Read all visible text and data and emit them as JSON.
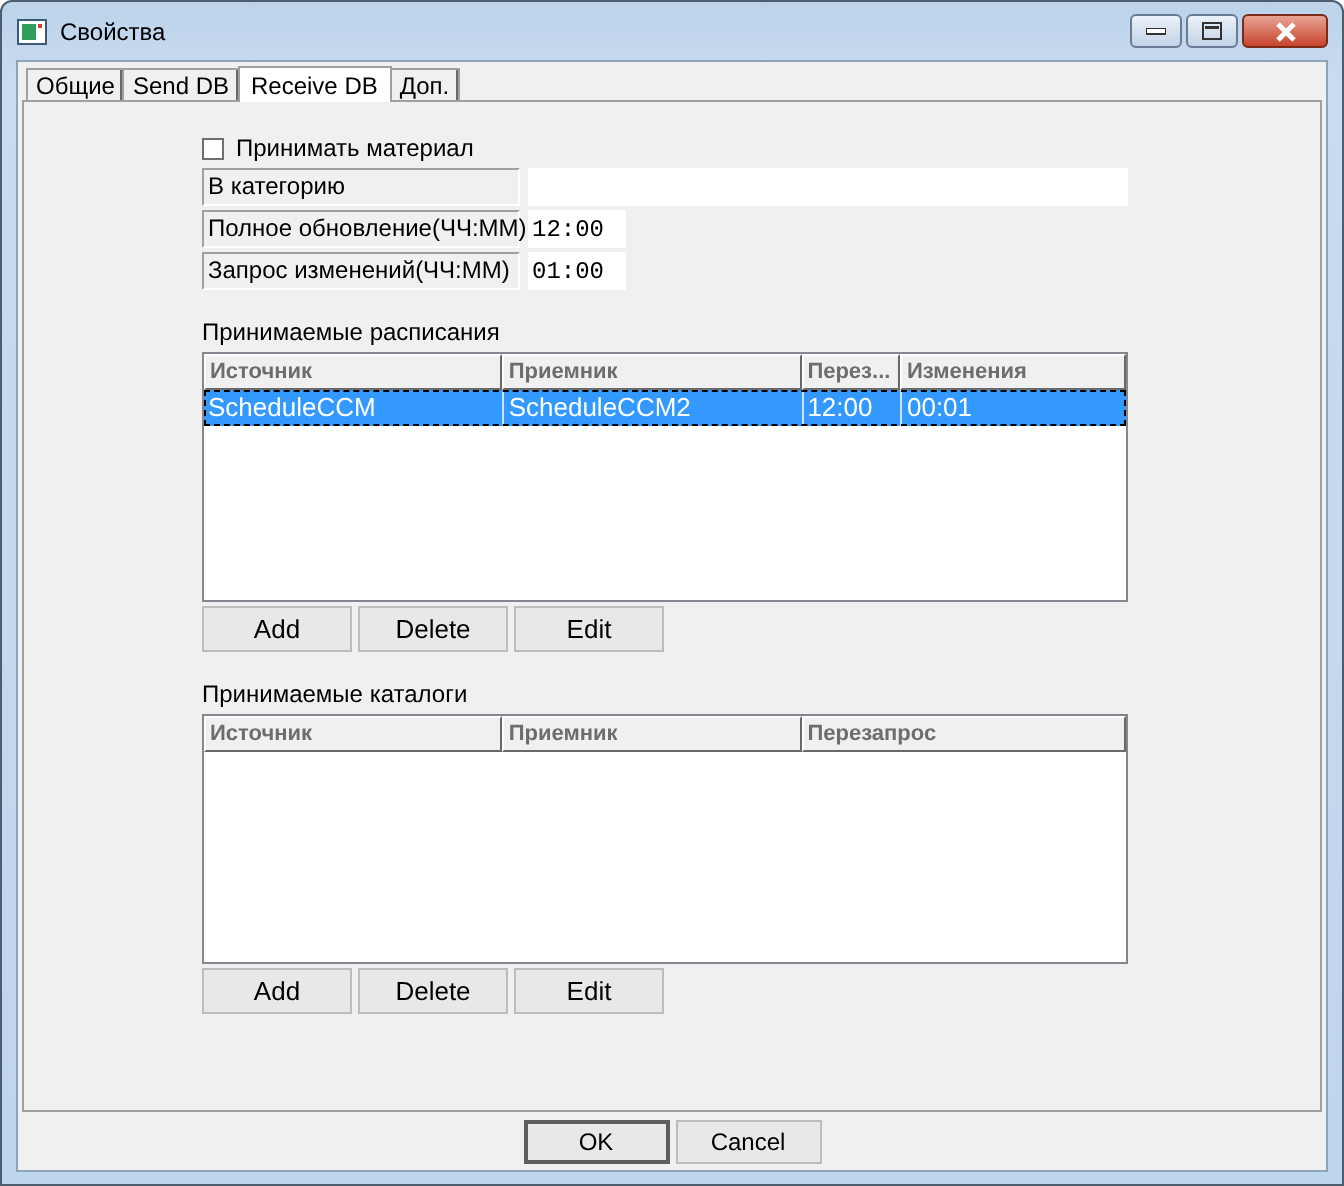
{
  "window": {
    "title": "Свойства"
  },
  "tabs": [
    {
      "label": "Общие",
      "selected": false
    },
    {
      "label": "Send DB",
      "selected": false
    },
    {
      "label": "Receive DB",
      "selected": true
    },
    {
      "label": "Доп.",
      "selected": false
    }
  ],
  "accept_material": {
    "label": "Принимать материал",
    "checked": false
  },
  "fields": [
    {
      "label": "В категорию",
      "kind": "wide"
    },
    {
      "label": "Полное обновление(ЧЧ:ММ)",
      "value": "12:00",
      "kind": "short"
    },
    {
      "label": "Запрос изменений(ЧЧ:ММ)",
      "value": "01:00",
      "kind": "short"
    }
  ],
  "schedules": {
    "title": "Принимаемые расписания",
    "columns": [
      "Источник",
      "Приемник",
      "Перез...",
      "Изменения"
    ],
    "rows": [
      {
        "cells": [
          "ScheduleCCM",
          "ScheduleCCM2",
          "12:00",
          "00:01"
        ],
        "selected": true
      }
    ],
    "buttons": [
      "Add",
      "Delete",
      "Edit"
    ]
  },
  "catalogs": {
    "title": "Принимаемые каталоги",
    "columns": [
      "Источник",
      "Приемник",
      "Перезапрос"
    ],
    "buttons": [
      "Add",
      "Delete",
      "Edit"
    ]
  },
  "dialog_buttons": [
    {
      "label": "OK",
      "default": true
    },
    {
      "label": "Cancel",
      "default": false
    }
  ]
}
